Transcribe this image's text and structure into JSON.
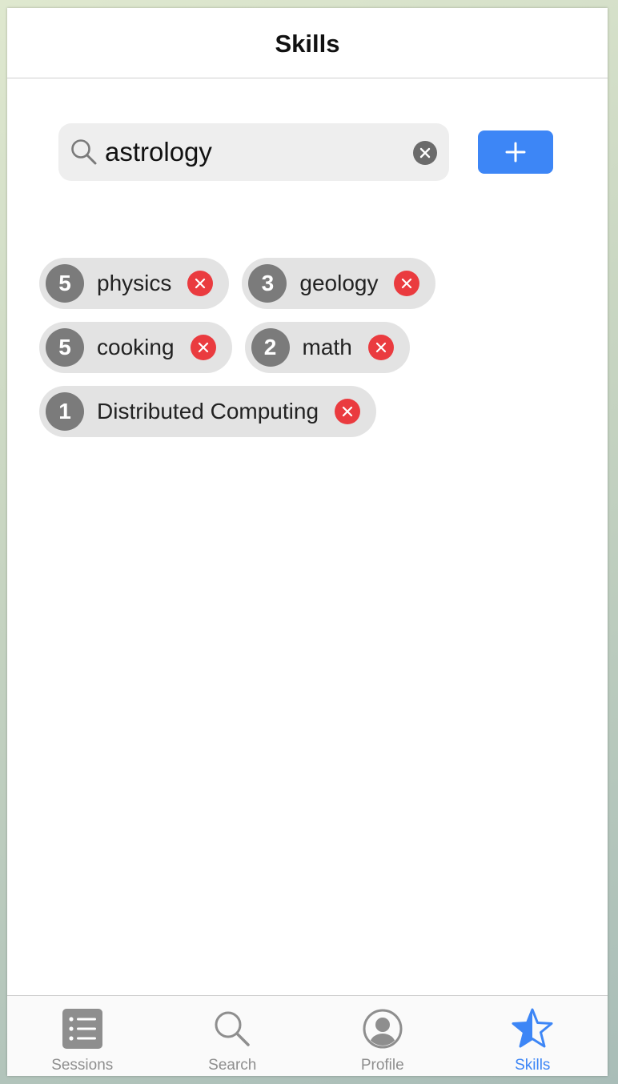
{
  "header": {
    "title": "Skills"
  },
  "search": {
    "value": "astrology",
    "placeholder": ""
  },
  "skills": [
    {
      "count": "5",
      "name": "physics"
    },
    {
      "count": "3",
      "name": "geology"
    },
    {
      "count": "5",
      "name": "cooking"
    },
    {
      "count": "2",
      "name": "math"
    },
    {
      "count": "1",
      "name": "Distributed Computing"
    }
  ],
  "tabs": [
    {
      "label": "Sessions",
      "icon": "list-icon"
    },
    {
      "label": "Search",
      "icon": "search-icon"
    },
    {
      "label": "Profile",
      "icon": "person-icon"
    },
    {
      "label": "Skills",
      "icon": "star-icon",
      "active": true
    }
  ],
  "colors": {
    "accent": "#3d86f6",
    "remove": "#ea3b3f",
    "chip_bg": "#e3e3e3",
    "count_bg": "#7b7b7b",
    "tab_inactive": "#8e8e8e"
  }
}
